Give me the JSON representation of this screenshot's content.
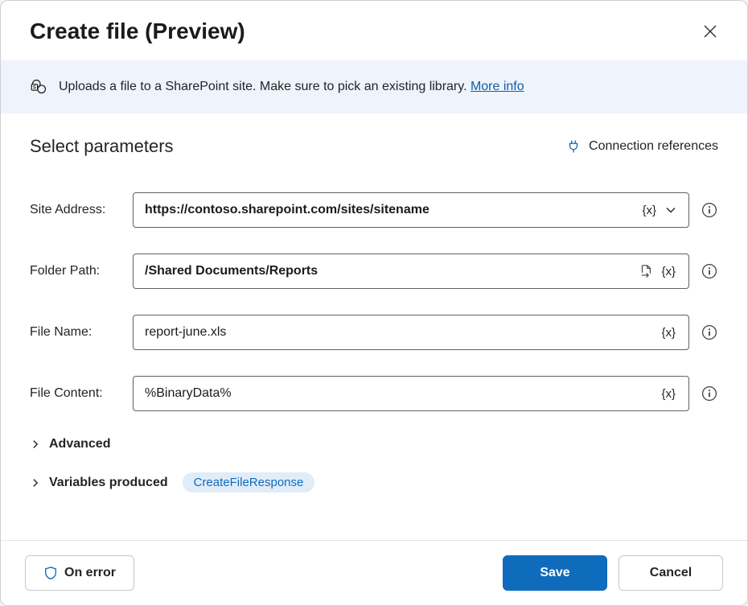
{
  "title": "Create file (Preview)",
  "info": {
    "text": "Uploads a file to a SharePoint site. Make sure to pick an existing library. ",
    "link": "More info"
  },
  "paramsHeader": "Select parameters",
  "connRef": "Connection references",
  "fields": {
    "siteAddress": {
      "label": "Site Address:",
      "value": "https://contoso.sharepoint.com/sites/sitename"
    },
    "folderPath": {
      "label": "Folder Path:",
      "value": "/Shared Documents/Reports"
    },
    "fileName": {
      "label": "File Name:",
      "value": "report-june.xls"
    },
    "fileContent": {
      "label": "File Content:",
      "value": "%BinaryData%"
    }
  },
  "varToken": "{x}",
  "advanced": "Advanced",
  "varsProduced": "Variables produced",
  "varsChip": "CreateFileResponse",
  "footer": {
    "onError": "On error",
    "save": "Save",
    "cancel": "Cancel"
  }
}
